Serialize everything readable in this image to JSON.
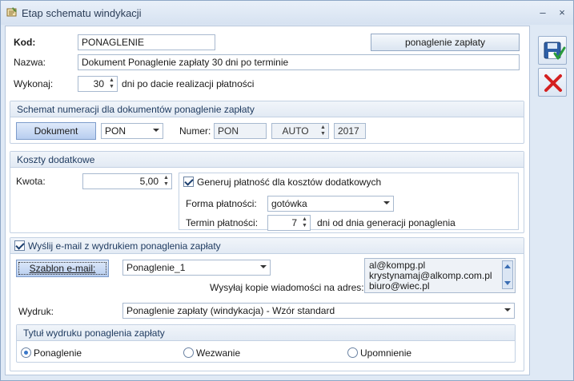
{
  "window": {
    "title": "Etap schematu windykacji",
    "minimize": "–",
    "close": "×"
  },
  "form": {
    "kod_label": "Kod:",
    "kod_value": "PONAGLENIE",
    "kod_button": "ponaglenie zapłaty",
    "nazwa_label": "Nazwa:",
    "nazwa_value": "Dokument Ponaglenie zapłaty 30 dni po terminie",
    "wykonaj_label": "Wykonaj:",
    "wykonaj_value": "30",
    "wykonaj_suffix": "dni po dacie realizacji płatności"
  },
  "numeracja": {
    "title": "Schemat numeracji dla dokumentów ponaglenie zapłaty",
    "dokument_button": "Dokument",
    "symbol_value": "PON",
    "numer_label": "Numer:",
    "numer_value": "PON",
    "auto_value": "AUTO",
    "year_value": "2017"
  },
  "koszty": {
    "title": "Koszty dodatkowe",
    "kwota_label": "Kwota:",
    "kwota_value": "5,00",
    "generuj_label": "Generuj płatność dla kosztów dodatkowych",
    "forma_label": "Forma płatności:",
    "forma_value": "gotówka",
    "termin_label": "Termin płatności:",
    "termin_value": "7",
    "termin_suffix": "dni od dnia generacji ponaglenia"
  },
  "email": {
    "send_label": "Wyślij e-mail z wydrukiem ponaglenia zapłaty",
    "szablon_button": "Szablon e-mail:",
    "szablon_value": "Ponaglenie_1",
    "kopie_label": "Wysyłaj kopie wiadomości na adres:",
    "addresses": [
      "al@kompg.pl",
      "krystynamaj@alkomp.com.pl",
      "biuro@wiec.pl"
    ],
    "wydruk_label": "Wydruk:",
    "wydruk_value": "Ponaglenie zapłaty (windykacja) - Wzór standard"
  },
  "tytul": {
    "title": "Tytuł wydruku ponaglenia zapłaty",
    "options": [
      "Ponaglenie",
      "Wezwanie",
      "Upomnienie"
    ],
    "selected": "Ponaglenie"
  },
  "icons": {
    "save": "save-disk-icon",
    "cancel": "cancel-x-icon"
  },
  "colors": {
    "accent": "#3a78c9",
    "cancel_red": "#d42020",
    "header_bg": "#dfe9f5"
  }
}
